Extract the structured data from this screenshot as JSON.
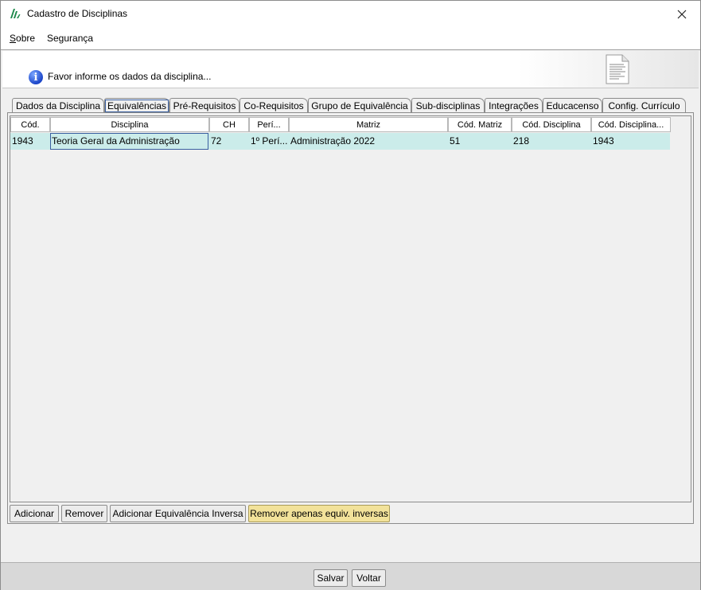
{
  "window": {
    "title": "Cadastro de Disciplinas",
    "close_icon": "close-icon"
  },
  "menu": {
    "items": [
      {
        "label": "Sobre",
        "mnemonic": "S",
        "rest": "obre"
      },
      {
        "label": "Segurança"
      }
    ]
  },
  "header": {
    "message": "Favor informe os dados da disciplina...",
    "info_icon": "info-icon",
    "doc_icon": "document-icon"
  },
  "tabs": [
    {
      "label": "Dados da Disciplina"
    },
    {
      "label": "Equivalências",
      "active": true
    },
    {
      "label": "Pré-Requisitos"
    },
    {
      "label": "Co-Requisitos"
    },
    {
      "label": "Grupo de Equivalência"
    },
    {
      "label": "Sub-disciplinas"
    },
    {
      "label": "Integrações"
    },
    {
      "label": "Educacenso"
    },
    {
      "label": "Config. Currículo"
    }
  ],
  "table": {
    "columns": [
      "Cód.",
      "Disciplina",
      "CH",
      "Perí...",
      "Matriz",
      "Cód. Matriz",
      "Cód. Disciplina",
      "Cód. Disciplina..."
    ],
    "rows": [
      [
        "1943",
        "Teoria Geral da Administração",
        "72",
        "1º Perí...",
        "Administração 2022",
        "51",
        "218",
        "1943"
      ]
    ]
  },
  "actions": {
    "add": "Adicionar",
    "remove": "Remover",
    "add_inverse": "Adicionar Equivalência Inversa",
    "remove_inverse": "Remover apenas equiv. inversas"
  },
  "footer": {
    "save": "Salvar",
    "back": "Voltar"
  }
}
